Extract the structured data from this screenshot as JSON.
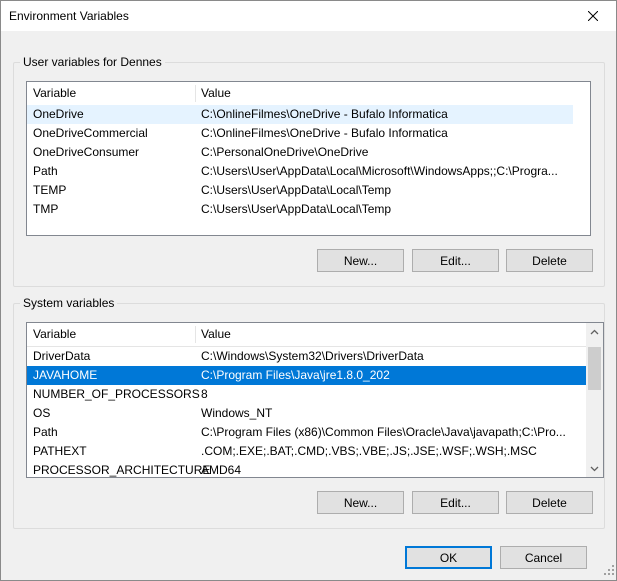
{
  "window": {
    "title": "Environment Variables"
  },
  "user_group": {
    "label": "User variables for Dennes",
    "columns": {
      "variable": "Variable",
      "value": "Value"
    },
    "rows": [
      {
        "variable": "OneDrive",
        "value": "C:\\OnlineFilmes\\OneDrive - Bufalo Informatica"
      },
      {
        "variable": "OneDriveCommercial",
        "value": "C:\\OnlineFilmes\\OneDrive - Bufalo Informatica"
      },
      {
        "variable": "OneDriveConsumer",
        "value": "C:\\PersonalOneDrive\\OneDrive"
      },
      {
        "variable": "Path",
        "value": "C:\\Users\\User\\AppData\\Local\\Microsoft\\WindowsApps;;C:\\Progra..."
      },
      {
        "variable": "TEMP",
        "value": "C:\\Users\\User\\AppData\\Local\\Temp"
      },
      {
        "variable": "TMP",
        "value": "C:\\Users\\User\\AppData\\Local\\Temp"
      }
    ],
    "buttons": {
      "new": "New...",
      "edit": "Edit...",
      "delete": "Delete"
    }
  },
  "system_group": {
    "label": "System variables",
    "columns": {
      "variable": "Variable",
      "value": "Value"
    },
    "rows": [
      {
        "variable": "DriverData",
        "value": "C:\\Windows\\System32\\Drivers\\DriverData"
      },
      {
        "variable": "JAVAHOME",
        "value": "C:\\Program Files\\Java\\jre1.8.0_202"
      },
      {
        "variable": "NUMBER_OF_PROCESSORS",
        "value": "8"
      },
      {
        "variable": "OS",
        "value": "Windows_NT"
      },
      {
        "variable": "Path",
        "value": "C:\\Program Files (x86)\\Common Files\\Oracle\\Java\\javapath;C:\\Pro..."
      },
      {
        "variable": "PATHEXT",
        "value": ".COM;.EXE;.BAT;.CMD;.VBS;.VBE;.JS;.JSE;.WSF;.WSH;.MSC"
      },
      {
        "variable": "PROCESSOR_ARCHITECTURE",
        "value": "AMD64"
      }
    ],
    "buttons": {
      "new": "New...",
      "edit": "Edit...",
      "delete": "Delete"
    }
  },
  "dialog_buttons": {
    "ok": "OK",
    "cancel": "Cancel"
  },
  "colors": {
    "selection": "#0078d7",
    "hover": "#e5f3ff",
    "background": "#f0f0f0"
  },
  "icons": {
    "close": "close-icon",
    "scroll_up": "chevron-up-icon",
    "scroll_down": "chevron-down-icon",
    "grip": "resize-grip-icon"
  }
}
